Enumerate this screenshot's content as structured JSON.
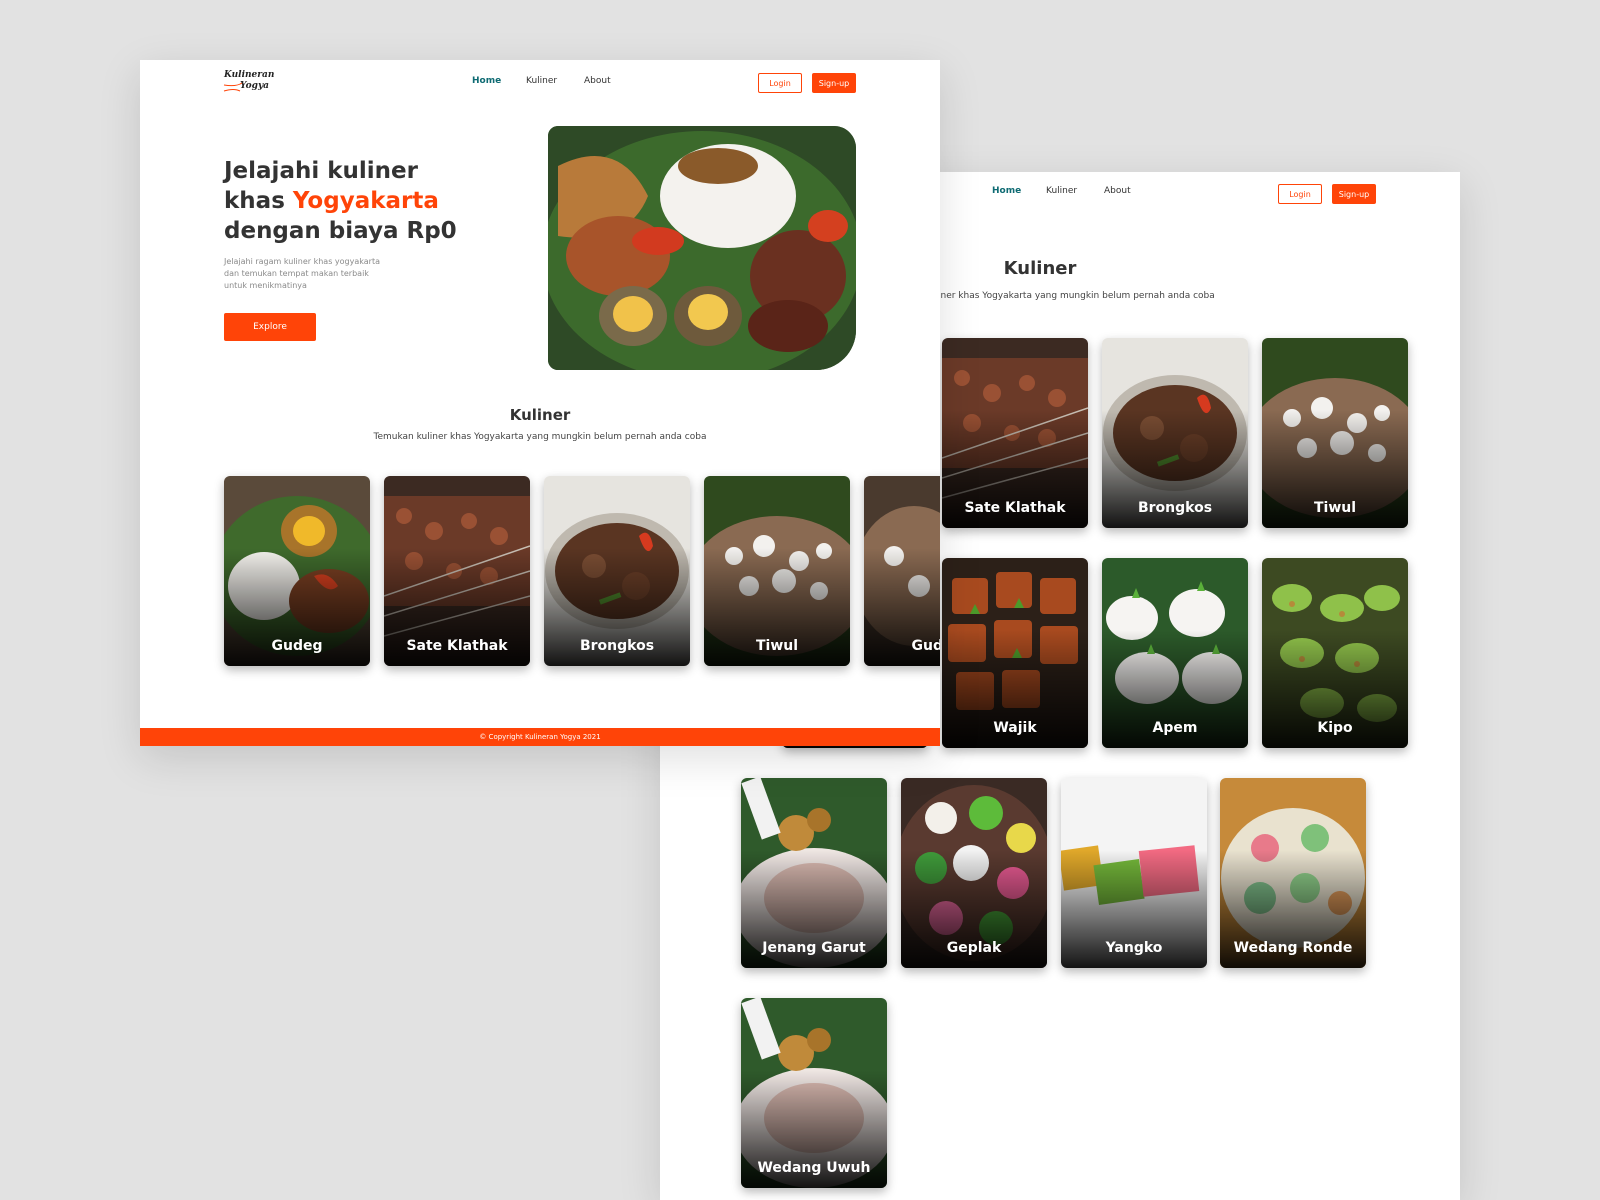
{
  "brand": {
    "line1": "Kulineran",
    "line2": "Yogya",
    "accent": "#ff4408",
    "nav_active": "#0e6b73"
  },
  "nav": {
    "home": "Home",
    "kuliner": "Kuliner",
    "about": "About",
    "login": "Login",
    "signup": "Sign-up"
  },
  "hero": {
    "title_1": "Jelajahi kuliner khas ",
    "title_accent": "Yogyakarta",
    "title_2": " dengan biaya Rp0",
    "description": "Jelajahi ragam kuliner khas yogyakarta dan temukan tempat makan terbaik untuk menikmatinya",
    "explore": "Explore"
  },
  "kuliner_section": {
    "title": "Kuliner",
    "subtitle": "Temukan kuliner khas Yogyakarta yang mungkin belum pernah anda coba",
    "subtitle_cropped": "iner khas Yogyakarta yang mungkin belum pernah anda coba"
  },
  "front_cards": [
    {
      "label": "Gudeg",
      "icon": "gudeg-photo"
    },
    {
      "label": "Sate Klathak",
      "icon": "sate-klathak-photo"
    },
    {
      "label": "Brongkos",
      "icon": "brongkos-photo"
    },
    {
      "label": "Tiwul",
      "icon": "tiwul-photo"
    },
    {
      "label": "Gudeg",
      "icon": "gudeg-photo"
    }
  ],
  "back_cards": [
    {
      "label": "Sate Klathak"
    },
    {
      "label": "Brongkos"
    },
    {
      "label": "Tiwul"
    },
    {
      "label": "Wajik"
    },
    {
      "label": "Apem"
    },
    {
      "label": "Kipo"
    },
    {
      "label": "Jenang Garut"
    },
    {
      "label": "Geplak"
    },
    {
      "label": "Yangko"
    },
    {
      "label": "Wedang Ronde"
    },
    {
      "label": "Wedang Uwuh"
    }
  ],
  "footer": {
    "text": "© Copyright Kulineran Yogya 2021"
  }
}
